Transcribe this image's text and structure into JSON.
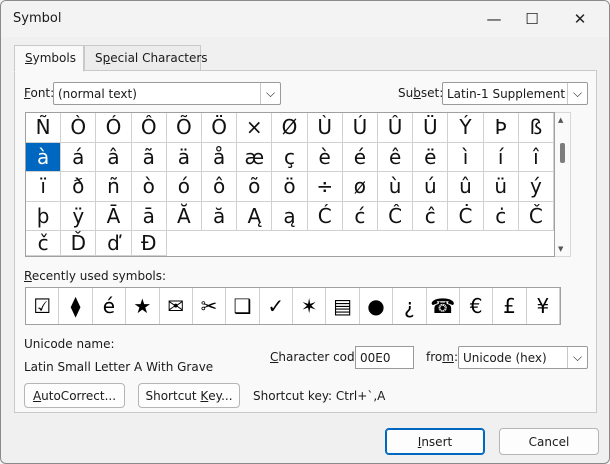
{
  "window": {
    "title": "Symbol",
    "minimize_glyph": "—",
    "maximize_glyph": "☐",
    "close_glyph": "✕"
  },
  "tabs": [
    {
      "pre": "",
      "mnemonic": "S",
      "post": "ymbols",
      "active": true
    },
    {
      "pre": "S",
      "mnemonic": "p",
      "post": "ecial Characters",
      "active": false
    }
  ],
  "font": {
    "label_mnemonic": "F",
    "label_rest": "ont:",
    "value": "(normal text)"
  },
  "subset": {
    "label_pre": "Su",
    "label_mnemonic": "b",
    "label_rest": "set:",
    "value": "Latin-1 Supplement"
  },
  "dropdown_arrow": "⌵",
  "symbols": [
    "Ñ",
    "Ò",
    "Ó",
    "Ô",
    "Õ",
    "Ö",
    "×",
    "Ø",
    "Ù",
    "Ú",
    "Û",
    "Ü",
    "Ý",
    "Þ",
    "ß",
    "à",
    "á",
    "â",
    "ã",
    "ä",
    "å",
    "æ",
    "ç",
    "è",
    "é",
    "ê",
    "ë",
    "ì",
    "í",
    "î",
    "ï",
    "ð",
    "ñ",
    "ò",
    "ó",
    "ô",
    "õ",
    "ö",
    "÷",
    "ø",
    "ù",
    "ú",
    "û",
    "ü",
    "ý",
    "þ",
    "ÿ",
    "Ā",
    "ā",
    "Ă",
    "ă",
    "Ą",
    "ą",
    "Ć",
    "ć",
    "Ĉ",
    "ĉ",
    "Ċ",
    "ċ",
    "Č",
    "č",
    "Ď",
    "ď",
    "Đ"
  ],
  "selected_index": 15,
  "recent": {
    "label_mnemonic": "R",
    "label_rest": "ecently used symbols:",
    "items": [
      "☑",
      "⧫",
      "é",
      "★",
      "✉",
      "✂",
      "❑",
      "✓",
      "✶",
      "▤",
      "●",
      "¿",
      "☎",
      "€",
      "£",
      "¥"
    ]
  },
  "unicode": {
    "label": "Unicode name:",
    "name": "Latin Small Letter A With Grave"
  },
  "char_code": {
    "label_mnemonic": "C",
    "label_rest": "haracter code:",
    "value": "00E0"
  },
  "from": {
    "label_pre": "fro",
    "label_mnemonic": "m",
    "label_rest": ":",
    "value": "Unicode (hex)"
  },
  "buttons": {
    "autocorrect_mnemonic": "A",
    "autocorrect_rest": "utoCorrect...",
    "shortcut_pre": "Shortcut ",
    "shortcut_mnemonic": "K",
    "shortcut_rest": "ey...",
    "shortcut_text": "Shortcut key: Ctrl+`,A",
    "insert_mnemonic": "I",
    "insert_rest": "nsert",
    "cancel": "Cancel"
  },
  "colors": {
    "accent": "#0067c0"
  }
}
